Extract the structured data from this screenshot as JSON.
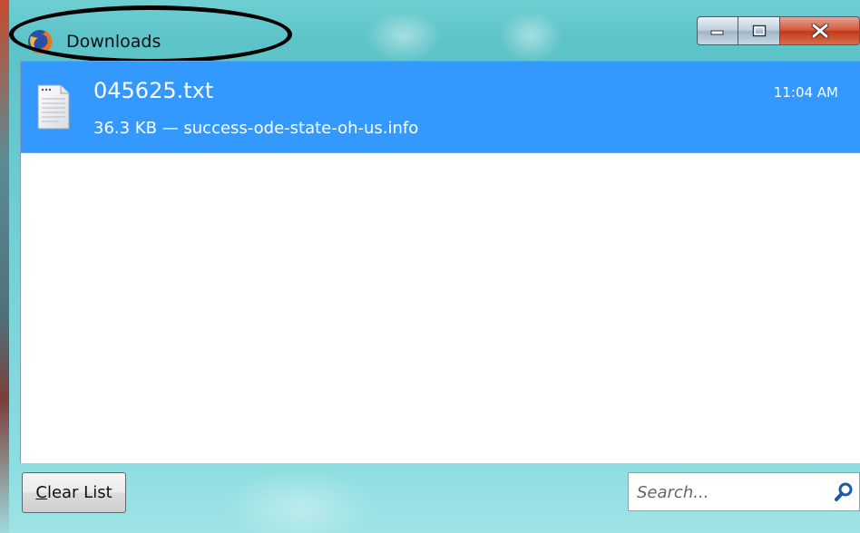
{
  "window": {
    "title": "Downloads",
    "controls": {
      "minimize": "minimize-icon",
      "maximize": "maximize-icon",
      "close": "close-icon"
    }
  },
  "downloads": [
    {
      "filename": "045625.txt",
      "status": "36.3 KB — success-ode-state-oh-us.info",
      "time": "11:04 AM",
      "icon": "text-file-icon",
      "selected": true
    }
  ],
  "footer": {
    "clear_label_access_key": "C",
    "clear_label_rest": "lear List",
    "search_placeholder": "Search..."
  },
  "colors": {
    "selection": "#3399ff",
    "annotation_oval": "#000000"
  }
}
